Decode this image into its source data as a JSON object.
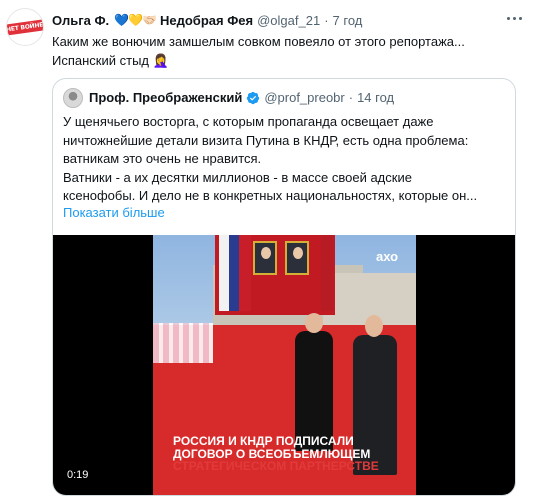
{
  "tweet": {
    "avatar_text": "НЕТ ВОЙНЕ",
    "author_name": "Ольга Ф.",
    "hearts": "💙💛🤝🏻",
    "author_name2": "Недобрая Фея",
    "handle": "@olgaf_21",
    "separator": "·",
    "time": "7 год",
    "text_lines": [
      "Каким же вонючим замшелым совком повеяло от этого репортажа...",
      "Испанский стыд 🤦‍♀️"
    ]
  },
  "quote": {
    "name": "Проф. Преображенский",
    "handle": "@prof_preobr",
    "separator": "·",
    "time": "14 год",
    "text_lines": [
      "У щенячьего восторга, с которым пропаганда освещает даже",
      "ничтожнейшие детали визита Путина в КНДР, есть одна проблема:",
      "ватникам это очень не нравится.",
      "Ватники - а их десятки миллионов - в массе своей адские",
      "ксенофобы. И дело не в конкретных национальностях, которые он..."
    ],
    "show_more": "Показати більше"
  },
  "media": {
    "logo": "ахо",
    "caption_line1": "РОССИЯ И КНДР ПОДПИСАЛИ",
    "caption_line2": "ДОГОВОР О ВСЕОБЪЕМЛЮЩЕМ",
    "caption_line3": "СТРАТЕГИЧЕСКОМ ПАРТНЕРСТВЕ",
    "duration": "0:19"
  },
  "colors": {
    "link": "#1d9bf0",
    "secondary_text": "#536471",
    "border": "#cfd9de",
    "caption_highlight": "#e23a3a"
  }
}
